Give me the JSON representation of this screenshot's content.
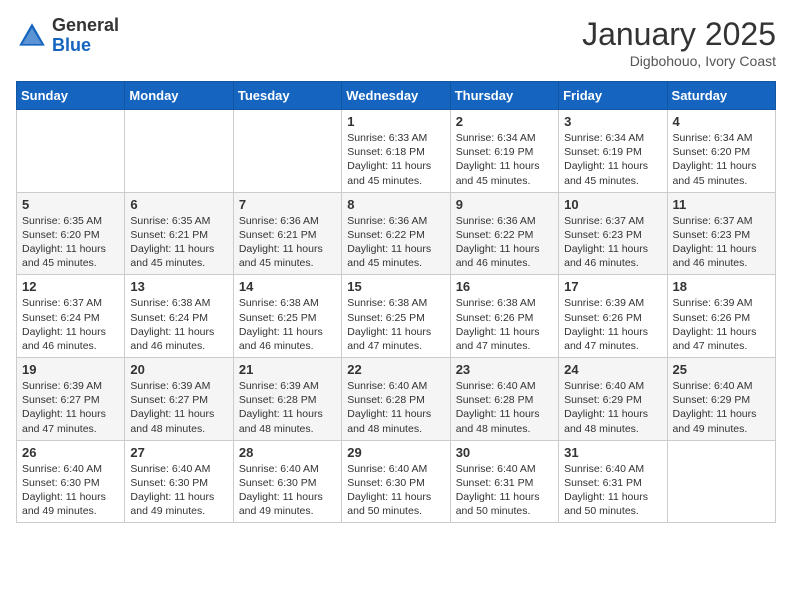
{
  "header": {
    "logo_general": "General",
    "logo_blue": "Blue",
    "month": "January 2025",
    "location": "Digbohouo, Ivory Coast"
  },
  "weekdays": [
    "Sunday",
    "Monday",
    "Tuesday",
    "Wednesday",
    "Thursday",
    "Friday",
    "Saturday"
  ],
  "weeks": [
    [
      {
        "day": "",
        "info": ""
      },
      {
        "day": "",
        "info": ""
      },
      {
        "day": "",
        "info": ""
      },
      {
        "day": "1",
        "info": "Sunrise: 6:33 AM\nSunset: 6:18 PM\nDaylight: 11 hours and 45 minutes."
      },
      {
        "day": "2",
        "info": "Sunrise: 6:34 AM\nSunset: 6:19 PM\nDaylight: 11 hours and 45 minutes."
      },
      {
        "day": "3",
        "info": "Sunrise: 6:34 AM\nSunset: 6:19 PM\nDaylight: 11 hours and 45 minutes."
      },
      {
        "day": "4",
        "info": "Sunrise: 6:34 AM\nSunset: 6:20 PM\nDaylight: 11 hours and 45 minutes."
      }
    ],
    [
      {
        "day": "5",
        "info": "Sunrise: 6:35 AM\nSunset: 6:20 PM\nDaylight: 11 hours and 45 minutes."
      },
      {
        "day": "6",
        "info": "Sunrise: 6:35 AM\nSunset: 6:21 PM\nDaylight: 11 hours and 45 minutes."
      },
      {
        "day": "7",
        "info": "Sunrise: 6:36 AM\nSunset: 6:21 PM\nDaylight: 11 hours and 45 minutes."
      },
      {
        "day": "8",
        "info": "Sunrise: 6:36 AM\nSunset: 6:22 PM\nDaylight: 11 hours and 45 minutes."
      },
      {
        "day": "9",
        "info": "Sunrise: 6:36 AM\nSunset: 6:22 PM\nDaylight: 11 hours and 46 minutes."
      },
      {
        "day": "10",
        "info": "Sunrise: 6:37 AM\nSunset: 6:23 PM\nDaylight: 11 hours and 46 minutes."
      },
      {
        "day": "11",
        "info": "Sunrise: 6:37 AM\nSunset: 6:23 PM\nDaylight: 11 hours and 46 minutes."
      }
    ],
    [
      {
        "day": "12",
        "info": "Sunrise: 6:37 AM\nSunset: 6:24 PM\nDaylight: 11 hours and 46 minutes."
      },
      {
        "day": "13",
        "info": "Sunrise: 6:38 AM\nSunset: 6:24 PM\nDaylight: 11 hours and 46 minutes."
      },
      {
        "day": "14",
        "info": "Sunrise: 6:38 AM\nSunset: 6:25 PM\nDaylight: 11 hours and 46 minutes."
      },
      {
        "day": "15",
        "info": "Sunrise: 6:38 AM\nSunset: 6:25 PM\nDaylight: 11 hours and 47 minutes."
      },
      {
        "day": "16",
        "info": "Sunrise: 6:38 AM\nSunset: 6:26 PM\nDaylight: 11 hours and 47 minutes."
      },
      {
        "day": "17",
        "info": "Sunrise: 6:39 AM\nSunset: 6:26 PM\nDaylight: 11 hours and 47 minutes."
      },
      {
        "day": "18",
        "info": "Sunrise: 6:39 AM\nSunset: 6:26 PM\nDaylight: 11 hours and 47 minutes."
      }
    ],
    [
      {
        "day": "19",
        "info": "Sunrise: 6:39 AM\nSunset: 6:27 PM\nDaylight: 11 hours and 47 minutes."
      },
      {
        "day": "20",
        "info": "Sunrise: 6:39 AM\nSunset: 6:27 PM\nDaylight: 11 hours and 48 minutes."
      },
      {
        "day": "21",
        "info": "Sunrise: 6:39 AM\nSunset: 6:28 PM\nDaylight: 11 hours and 48 minutes."
      },
      {
        "day": "22",
        "info": "Sunrise: 6:40 AM\nSunset: 6:28 PM\nDaylight: 11 hours and 48 minutes."
      },
      {
        "day": "23",
        "info": "Sunrise: 6:40 AM\nSunset: 6:28 PM\nDaylight: 11 hours and 48 minutes."
      },
      {
        "day": "24",
        "info": "Sunrise: 6:40 AM\nSunset: 6:29 PM\nDaylight: 11 hours and 48 minutes."
      },
      {
        "day": "25",
        "info": "Sunrise: 6:40 AM\nSunset: 6:29 PM\nDaylight: 11 hours and 49 minutes."
      }
    ],
    [
      {
        "day": "26",
        "info": "Sunrise: 6:40 AM\nSunset: 6:30 PM\nDaylight: 11 hours and 49 minutes."
      },
      {
        "day": "27",
        "info": "Sunrise: 6:40 AM\nSunset: 6:30 PM\nDaylight: 11 hours and 49 minutes."
      },
      {
        "day": "28",
        "info": "Sunrise: 6:40 AM\nSunset: 6:30 PM\nDaylight: 11 hours and 49 minutes."
      },
      {
        "day": "29",
        "info": "Sunrise: 6:40 AM\nSunset: 6:30 PM\nDaylight: 11 hours and 50 minutes."
      },
      {
        "day": "30",
        "info": "Sunrise: 6:40 AM\nSunset: 6:31 PM\nDaylight: 11 hours and 50 minutes."
      },
      {
        "day": "31",
        "info": "Sunrise: 6:40 AM\nSunset: 6:31 PM\nDaylight: 11 hours and 50 minutes."
      },
      {
        "day": "",
        "info": ""
      }
    ]
  ]
}
